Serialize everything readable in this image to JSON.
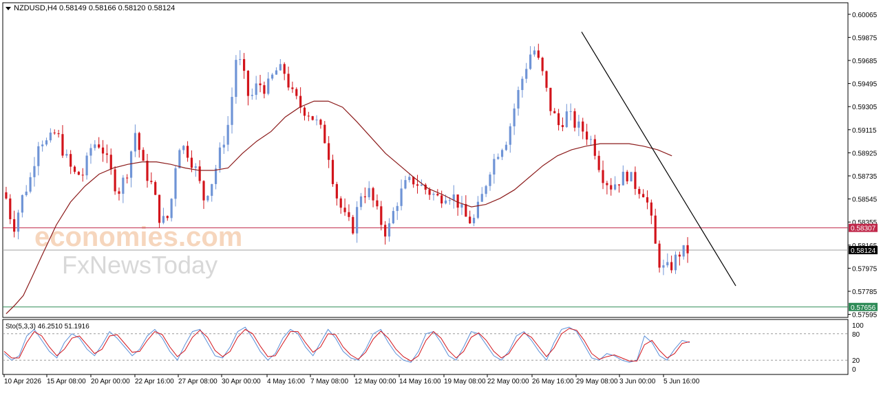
{
  "header": {
    "symbol": "NZDUSD,H4",
    "ohlc": "0.58149 0.58166 0.58120 0.58124"
  },
  "watermark": {
    "line1": "economies.com",
    "line2": "FxNewsToday"
  },
  "stochastic": {
    "label": "Sto(5,3,3) 46.2510 51.1916",
    "levels": [
      "100",
      "80",
      "20",
      "0"
    ]
  },
  "colors": {
    "bull": "#6f94d6",
    "bear": "#d2141b",
    "ma": "#8b1a1a",
    "resistance_line": "#c0284a",
    "support_line": "#2e8b57",
    "current_price_line": "#a0a0a0",
    "sto_main": "#5a8fd8",
    "sto_signal": "#d2141b"
  },
  "chart_data": {
    "type": "candlestick",
    "symbol": "NZDUSD",
    "timeframe": "H4",
    "y_ticks": [
      "0.60065",
      "0.59875",
      "0.59685",
      "0.59495",
      "0.59305",
      "0.59115",
      "0.58925",
      "0.58735",
      "0.58545",
      "0.58355",
      "0.58165",
      "0.57975",
      "0.57785",
      "0.57595"
    ],
    "x_ticks": [
      "10 Apr 2026",
      "15 Apr 08:00",
      "20 Apr 00:00",
      "22 Apr 16:00",
      "27 Apr 08:00",
      "30 Apr 00:00",
      "4 May 16:00",
      "7 May 08:00",
      "12 May 00:00",
      "14 May 16:00",
      "19 May 08:00",
      "22 May 00:00",
      "26 May 16:00",
      "29 May 08:00",
      "3 Jun 00:00",
      "5 Jun 16:00"
    ],
    "ylim": [
      0.5757,
      0.6016
    ],
    "price_tags": [
      {
        "value": 0.58307,
        "label": "0.58307",
        "color": "#c0284a"
      },
      {
        "value": 0.58124,
        "label": "0.58124",
        "color": "#000000"
      },
      {
        "value": 0.57656,
        "label": "0.57656",
        "color": "#2e8b57"
      }
    ],
    "close_path": [
      [
        0,
        0.5855
      ],
      [
        5,
        0.583
      ],
      [
        11,
        0.5855
      ],
      [
        17,
        0.5872
      ],
      [
        23,
        0.5905
      ],
      [
        29,
        0.59
      ],
      [
        35,
        0.591
      ],
      [
        41,
        0.589
      ],
      [
        47,
        0.5875
      ],
      [
        54,
        0.5875
      ],
      [
        60,
        0.59
      ],
      [
        66,
        0.59
      ],
      [
        72,
        0.588
      ],
      [
        78,
        0.586
      ],
      [
        84,
        0.5875
      ],
      [
        90,
        0.591
      ],
      [
        96,
        0.588
      ],
      [
        102,
        0.5865
      ],
      [
        108,
        0.5835
      ],
      [
        114,
        0.584
      ],
      [
        120,
        0.59
      ],
      [
        126,
        0.5895
      ],
      [
        132,
        0.588
      ],
      [
        138,
        0.5855
      ],
      [
        144,
        0.587
      ],
      [
        150,
        0.5895
      ],
      [
        156,
        0.592
      ],
      [
        161,
        0.5975
      ],
      [
        165,
        0.596
      ],
      [
        170,
        0.5935
      ],
      [
        176,
        0.595
      ],
      [
        182,
        0.5945
      ],
      [
        188,
        0.596
      ],
      [
        194,
        0.596
      ],
      [
        200,
        0.594
      ],
      [
        206,
        0.593
      ],
      [
        212,
        0.5925
      ],
      [
        218,
        0.5915
      ],
      [
        224,
        0.59
      ],
      [
        230,
        0.586
      ],
      [
        236,
        0.584
      ],
      [
        242,
        0.583
      ],
      [
        248,
        0.586
      ],
      [
        254,
        0.586
      ],
      [
        260,
        0.584
      ],
      [
        266,
        0.5825
      ],
      [
        272,
        0.585
      ],
      [
        278,
        0.5865
      ],
      [
        284,
        0.587
      ],
      [
        290,
        0.5865
      ],
      [
        296,
        0.586
      ],
      [
        302,
        0.5855
      ],
      [
        308,
        0.586
      ],
      [
        314,
        0.5855
      ],
      [
        320,
        0.584
      ],
      [
        326,
        0.5835
      ],
      [
        332,
        0.5855
      ],
      [
        338,
        0.588
      ],
      [
        344,
        0.5895
      ],
      [
        350,
        0.5905
      ],
      [
        356,
        0.5935
      ],
      [
        362,
        0.596
      ],
      [
        368,
        0.598
      ],
      [
        374,
        0.596
      ],
      [
        380,
        0.593
      ],
      [
        386,
        0.5915
      ],
      [
        392,
        0.5925
      ],
      [
        398,
        0.5915
      ],
      [
        404,
        0.591
      ],
      [
        410,
        0.59
      ],
      [
        416,
        0.5875
      ],
      [
        422,
        0.5865
      ],
      [
        428,
        0.587
      ],
      [
        434,
        0.5875
      ],
      [
        440,
        0.5865
      ],
      [
        446,
        0.586
      ],
      [
        450,
        0.584
      ],
      [
        455,
        0.5805
      ],
      [
        460,
        0.5795
      ],
      [
        465,
        0.58
      ],
      [
        470,
        0.581
      ],
      [
        476,
        0.5812
      ]
    ],
    "ma_path": [
      [
        0,
        0.576
      ],
      [
        6,
        0.5767
      ],
      [
        12,
        0.5775
      ],
      [
        18,
        0.579
      ],
      [
        25,
        0.5808
      ],
      [
        35,
        0.5833
      ],
      [
        45,
        0.5852
      ],
      [
        55,
        0.5865
      ],
      [
        65,
        0.5875
      ],
      [
        75,
        0.588
      ],
      [
        85,
        0.5883
      ],
      [
        95,
        0.5885
      ],
      [
        105,
        0.5885
      ],
      [
        115,
        0.5883
      ],
      [
        125,
        0.588
      ],
      [
        135,
        0.5878
      ],
      [
        145,
        0.5878
      ],
      [
        155,
        0.588
      ],
      [
        165,
        0.5892
      ],
      [
        175,
        0.5902
      ],
      [
        185,
        0.591
      ],
      [
        195,
        0.5922
      ],
      [
        205,
        0.593
      ],
      [
        215,
        0.5935
      ],
      [
        225,
        0.5935
      ],
      [
        235,
        0.593
      ],
      [
        245,
        0.5918
      ],
      [
        255,
        0.5905
      ],
      [
        265,
        0.5892
      ],
      [
        275,
        0.5882
      ],
      [
        285,
        0.5872
      ],
      [
        295,
        0.5863
      ],
      [
        305,
        0.5858
      ],
      [
        315,
        0.5852
      ],
      [
        325,
        0.5848
      ],
      [
        335,
        0.585
      ],
      [
        345,
        0.5855
      ],
      [
        355,
        0.5862
      ],
      [
        365,
        0.5872
      ],
      [
        375,
        0.5882
      ],
      [
        385,
        0.589
      ],
      [
        395,
        0.5895
      ],
      [
        405,
        0.5898
      ],
      [
        415,
        0.59
      ],
      [
        425,
        0.59
      ],
      [
        435,
        0.59
      ],
      [
        445,
        0.5898
      ],
      [
        455,
        0.5895
      ],
      [
        465,
        0.589
      ]
    ],
    "trendline": {
      "from": [
        0.5992,
        413
      ],
      "to": [
        0.5783,
        522
      ]
    },
    "sto_main": [
      35,
      20,
      30,
      75,
      90,
      65,
      40,
      25,
      60,
      80,
      70,
      45,
      30,
      55,
      85,
      70,
      50,
      30,
      45,
      75,
      90,
      70,
      40,
      20,
      55,
      85,
      90,
      60,
      30,
      25,
      50,
      85,
      95,
      70,
      40,
      20,
      35,
      70,
      90,
      80,
      50,
      30,
      60,
      90,
      70,
      40,
      25,
      20,
      45,
      80,
      90,
      60,
      35,
      20,
      15,
      40,
      80,
      85,
      60,
      30,
      20,
      50,
      85,
      80,
      55,
      30,
      20,
      40,
      75,
      85,
      65,
      40,
      20,
      60,
      90,
      95,
      85,
      55,
      25,
      20,
      35,
      30,
      20,
      15,
      20,
      75,
      60,
      30,
      20,
      45,
      65,
      60
    ],
    "sto_signal": [
      40,
      25,
      25,
      60,
      85,
      75,
      50,
      30,
      45,
      70,
      75,
      55,
      35,
      45,
      75,
      78,
      58,
      38,
      40,
      65,
      85,
      78,
      50,
      28,
      42,
      72,
      88,
      72,
      42,
      28,
      40,
      72,
      90,
      80,
      52,
      28,
      30,
      58,
      85,
      85,
      60,
      38,
      50,
      80,
      78,
      50,
      32,
      22,
      38,
      68,
      86,
      70,
      45,
      28,
      18,
      30,
      65,
      85,
      70,
      42,
      25,
      40,
      72,
      82,
      65,
      40,
      25,
      35,
      62,
      82,
      72,
      50,
      28,
      48,
      80,
      92,
      88,
      65,
      35,
      22,
      28,
      32,
      25,
      18,
      18,
      55,
      65,
      42,
      25,
      35,
      58,
      62
    ]
  }
}
